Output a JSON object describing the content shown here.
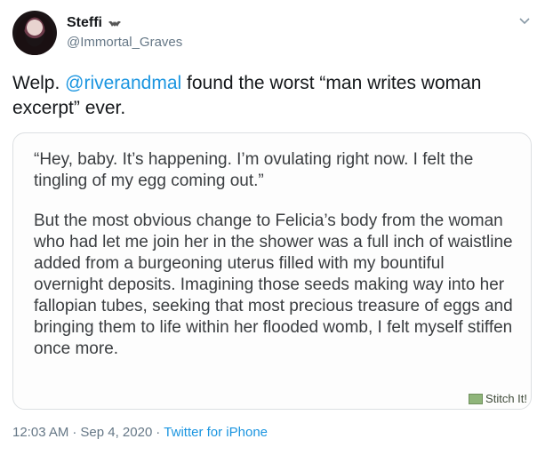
{
  "author": {
    "display_name": "Steffi",
    "handle": "@Immortal_Graves",
    "name_icon": "bat-icon",
    "avatar": "avatar-photo"
  },
  "tweet": {
    "text_before": "Welp. ",
    "mention": "@riverandmal",
    "text_after": " found the worst “man writes woman excerpt” ever."
  },
  "media": {
    "paragraphs": [
      "“Hey, baby. It’s happening. I’m ovulating right now. I felt the tingling of my egg coming out.”",
      "But the most obvious change to Felicia’s body from the woman who had let me join her in the shower was a full inch of waistline added from a burgeoning uterus filled with my bountiful overnight deposits. Imagining those seeds making way into her fallopian tubes, seeking that most precious treasure of eggs and bringing them to life within her flooded womb, I felt myself stiffen once more."
    ],
    "watermark": "Stitch It!"
  },
  "footer": {
    "time": "12:03 AM",
    "separator": "·",
    "date": "Sep 4, 2020",
    "source": "Twitter for iPhone"
  },
  "colors": {
    "link": "#1b95e0",
    "secondary_text": "#657786",
    "primary_text": "#14171a",
    "border": "#dcdfe2"
  }
}
